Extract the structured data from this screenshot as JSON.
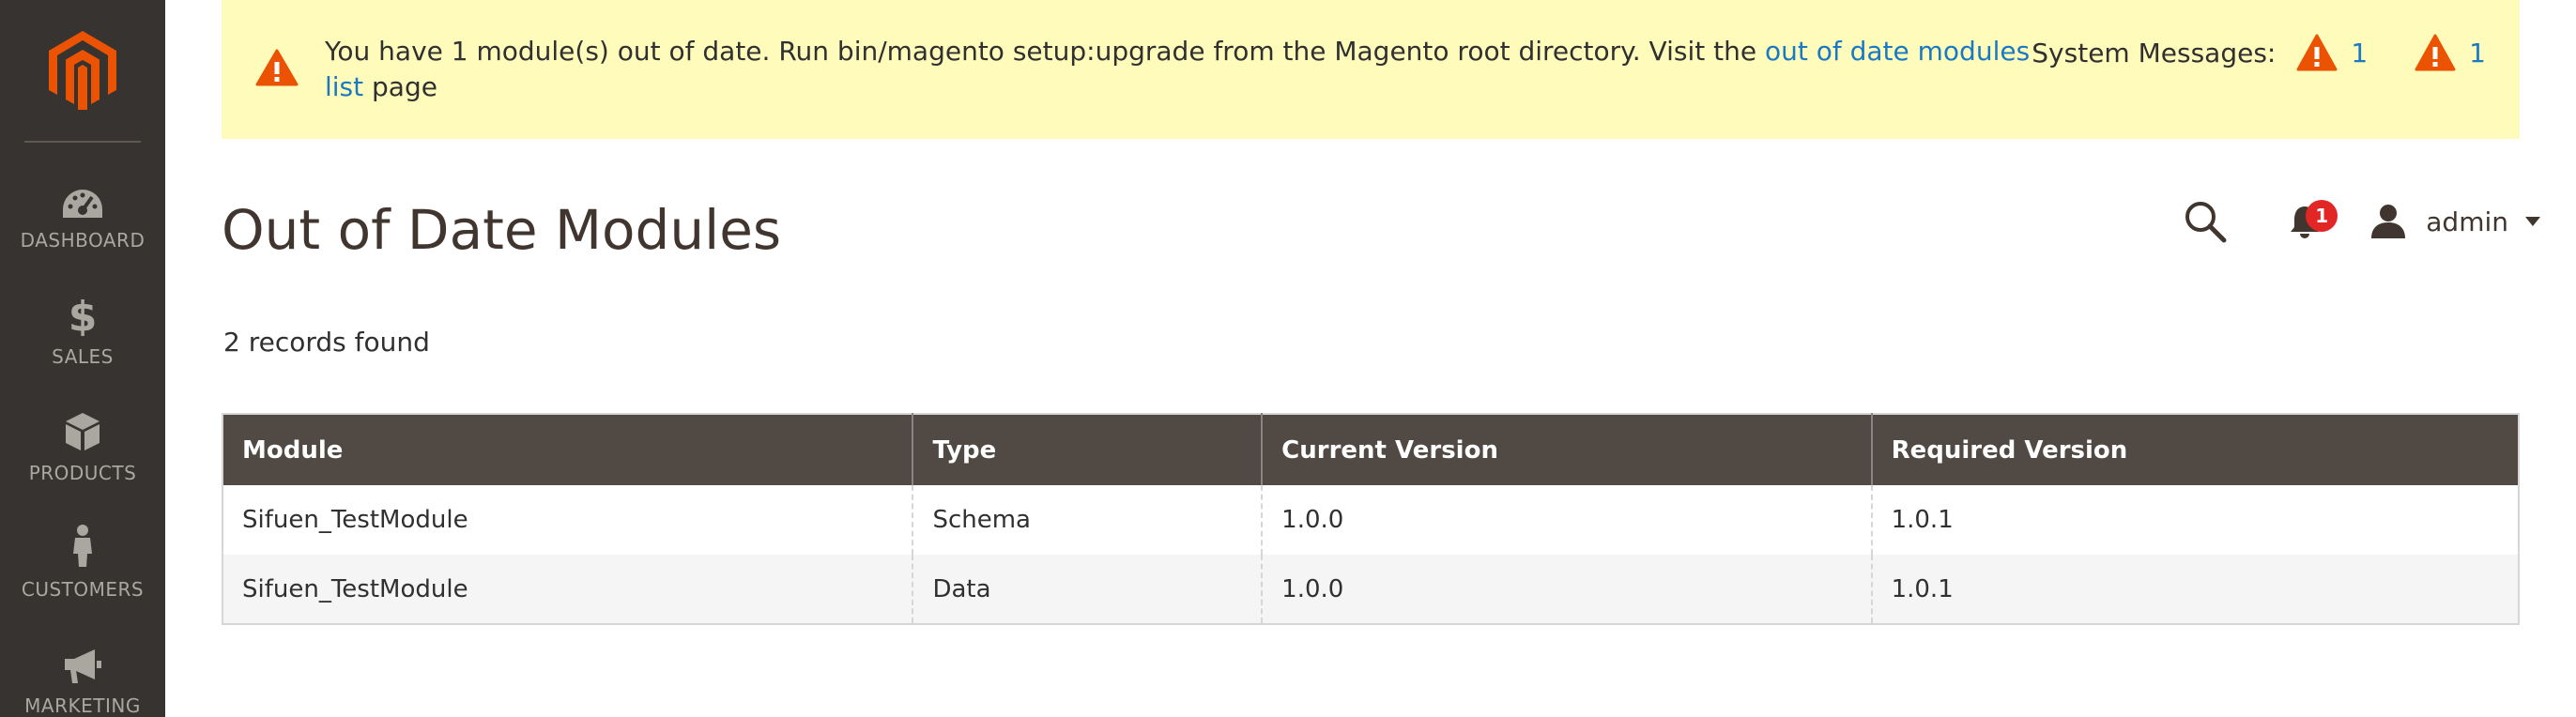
{
  "sidebar": {
    "items": [
      {
        "label": "DASHBOARD",
        "icon": "dashboard-icon"
      },
      {
        "label": "SALES",
        "icon": "dollar-icon"
      },
      {
        "label": "PRODUCTS",
        "icon": "cube-icon"
      },
      {
        "label": "CUSTOMERS",
        "icon": "person-icon"
      },
      {
        "label": "MARKETING",
        "icon": "megaphone-icon"
      }
    ]
  },
  "banner": {
    "text_before": "You have 1 module(s) out of date. Run bin/magento setup:upgrade from the Magento root directory. Visit the",
    "link_text": "out of date modules list",
    "text_after": "page",
    "system_messages_label": "System Messages:",
    "counts": [
      "1",
      "1"
    ]
  },
  "header": {
    "title": "Out of Date Modules",
    "notification_count": "1",
    "username": "admin"
  },
  "records_found": "2 records found",
  "table": {
    "headers": [
      "Module",
      "Type",
      "Current Version",
      "Required Version"
    ],
    "rows": [
      [
        "Sifuen_TestModule",
        "Schema",
        "1.0.0",
        "1.0.1"
      ],
      [
        "Sifuen_TestModule",
        "Data",
        "1.0.0",
        "1.0.1"
      ]
    ]
  },
  "colors": {
    "sidebar_bg": "#373330",
    "logo_orange": "#eb5202",
    "banner_bg": "#fffbbb",
    "link_blue": "#1979c3",
    "table_header_bg": "#514943",
    "badge_red": "#e22626"
  }
}
